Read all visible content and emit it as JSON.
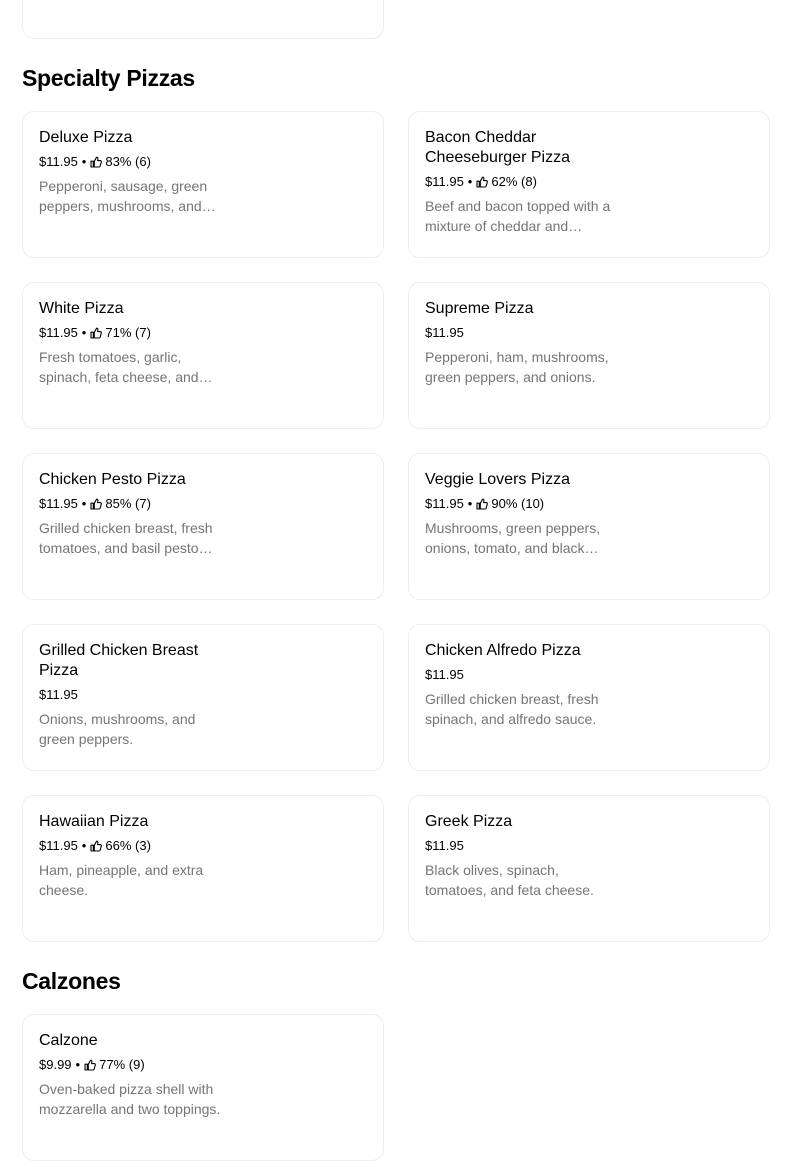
{
  "sections": [
    {
      "title": "Specialty Pizzas",
      "items": [
        {
          "name": "Deluxe Pizza",
          "price": "$11.95",
          "rating": "83%",
          "rating_count": "(6)",
          "description": "Pepperoni, sausage, green peppers, mushrooms, and onions."
        },
        {
          "name": "Bacon Cheddar Cheeseburger Pizza",
          "price": "$11.95",
          "rating": "62%",
          "rating_count": "(8)",
          "description": "Beef and bacon topped with a mixture of cheddar and mozzarella."
        },
        {
          "name": "White Pizza",
          "price": "$11.95",
          "rating": "71%",
          "rating_count": "(7)",
          "description": "Fresh tomatoes, garlic, spinach, feta cheese, and mozzarella."
        },
        {
          "name": "Supreme Pizza",
          "price": "$11.95",
          "rating": "",
          "rating_count": "",
          "description": "Pepperoni, ham, mushrooms, green peppers, and onions."
        },
        {
          "name": "Chicken Pesto Pizza",
          "price": "$11.95",
          "rating": "85%",
          "rating_count": "(7)",
          "description": "Grilled chicken breast, fresh tomatoes, and basil pesto sauce."
        },
        {
          "name": "Veggie Lovers Pizza",
          "price": "$11.95",
          "rating": "90%",
          "rating_count": "(10)",
          "description": "Mushrooms, green peppers, onions, tomato, and black olives."
        },
        {
          "name": "Grilled Chicken Breast Pizza",
          "price": "$11.95",
          "rating": "",
          "rating_count": "",
          "description": "Onions, mushrooms, and green peppers."
        },
        {
          "name": "Chicken Alfredo Pizza",
          "price": "$11.95",
          "rating": "",
          "rating_count": "",
          "description": "Grilled chicken breast, fresh spinach, and alfredo sauce."
        },
        {
          "name": "Hawaiian Pizza",
          "price": "$11.95",
          "rating": "66%",
          "rating_count": "(3)",
          "description": "Ham, pineapple, and extra cheese."
        },
        {
          "name": "Greek Pizza",
          "price": "$11.95",
          "rating": "",
          "rating_count": "",
          "description": "Black olives, spinach, tomatoes, and feta cheese."
        }
      ]
    },
    {
      "title": "Calzones",
      "items": [
        {
          "name": "Calzone",
          "price": "$9.99",
          "rating": "77%",
          "rating_count": "(9)",
          "description": "Oven-baked pizza shell with mozzarella and two toppings."
        }
      ]
    }
  ],
  "meta_separator": "•",
  "icons": {
    "rating": "thumbs-up-icon"
  },
  "colors": {
    "text": "#000000",
    "muted": "#757575",
    "border": "#eeeeee"
  }
}
